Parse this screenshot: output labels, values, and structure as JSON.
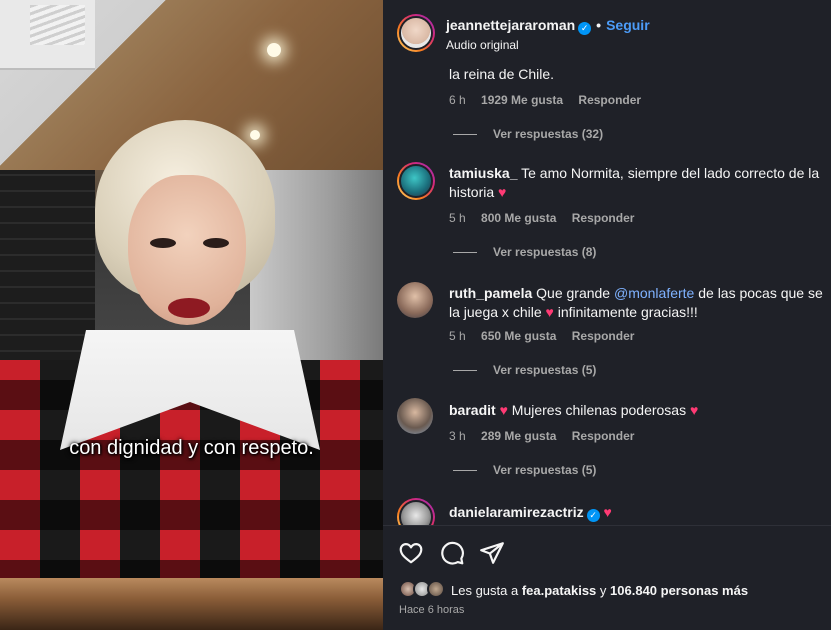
{
  "video": {
    "caption": "con dignidad y con respeto."
  },
  "header": {
    "username": "jeannettejararoman",
    "verified_mark": "✓",
    "separator": "•",
    "follow_label": "Seguir",
    "audio_label": "Audio original"
  },
  "comments": [
    {
      "username": "",
      "text": "la reina de Chile.",
      "time": "6 h",
      "likes": "1929 Me gusta",
      "reply_label": "Responder",
      "replies_label": "Ver respuestas (32)"
    },
    {
      "username": "tamiuska_",
      "text": "Te amo Normita, siempre del lado correcto de la historia",
      "emoji": "♥",
      "time": "5 h",
      "likes": "800 Me gusta",
      "reply_label": "Responder",
      "replies_label": "Ver respuestas (8)"
    },
    {
      "username": "ruth_pamela",
      "text_a": "Que grande",
      "mention": "@monlaferte",
      "text_b": "de las pocas que se la juega x chile",
      "emoji": "♥",
      "text_c": "infinitamente gracias!!!",
      "time": "5 h",
      "likes": "650 Me gusta",
      "reply_label": "Responder",
      "replies_label": "Ver respuestas (5)"
    },
    {
      "username": "baradit",
      "emoji": "♥",
      "text": "Mujeres chilenas poderosas",
      "time": "3 h",
      "likes": "289 Me gusta",
      "reply_label": "Responder",
      "replies_label": "Ver respuestas (5)"
    },
    {
      "username": "danielaramirezactriz",
      "verified_mark": "✓",
      "emoji": "♥"
    }
  ],
  "actions": {
    "like_icon": "heart-icon",
    "comment_icon": "comment-icon",
    "share_icon": "send-icon",
    "likes_prefix": "Les gusta a",
    "likes_user": "fea.patakiss",
    "likes_joiner": "y",
    "likes_count": "106.840 personas más",
    "time_ago": "Hace 6 horas"
  },
  "colors": {
    "panel_bg": "#1f2128",
    "link_blue": "#4c9cf8",
    "mention_blue": "#7fb2ff",
    "heart_pink": "#ff3a74",
    "muted_text": "#a8a8a8"
  }
}
